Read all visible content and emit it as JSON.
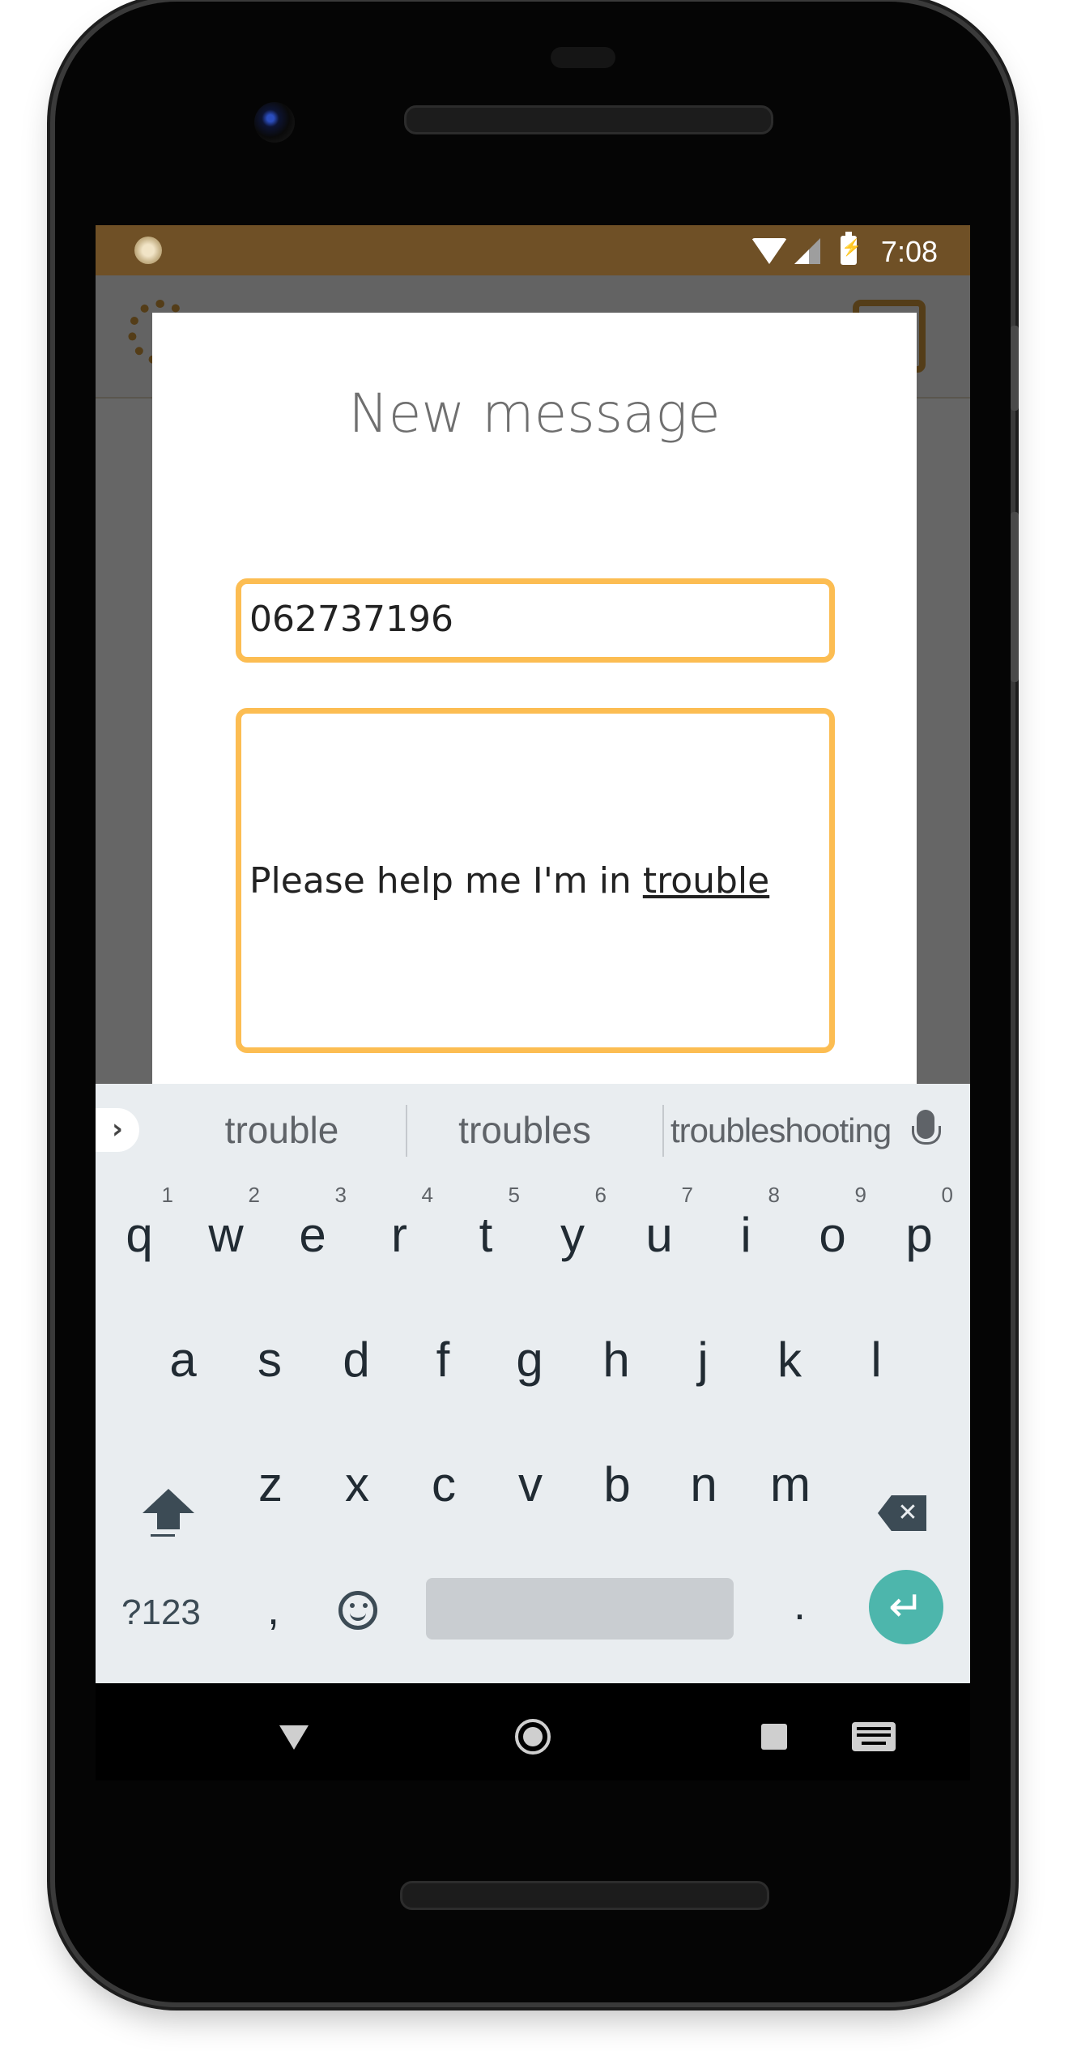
{
  "status_bar": {
    "time": "7:08"
  },
  "dialog": {
    "title": "New message",
    "phone_number": "062737196",
    "message_prefix": "Please help me I'm in ",
    "message_current_word": "trouble"
  },
  "keyboard": {
    "suggestions": [
      "trouble",
      "troubles",
      "troubleshooting"
    ],
    "row1": [
      {
        "letter": "q",
        "num": "1"
      },
      {
        "letter": "w",
        "num": "2"
      },
      {
        "letter": "e",
        "num": "3"
      },
      {
        "letter": "r",
        "num": "4"
      },
      {
        "letter": "t",
        "num": "5"
      },
      {
        "letter": "y",
        "num": "6"
      },
      {
        "letter": "u",
        "num": "7"
      },
      {
        "letter": "i",
        "num": "8"
      },
      {
        "letter": "o",
        "num": "9"
      },
      {
        "letter": "p",
        "num": "0"
      }
    ],
    "row2": [
      "a",
      "s",
      "d",
      "f",
      "g",
      "h",
      "j",
      "k",
      "l"
    ],
    "row3": [
      "z",
      "x",
      "c",
      "v",
      "b",
      "n",
      "m"
    ],
    "symbols_label": "?123",
    "comma": ",",
    "period": ".",
    "enter_glyph": "↵"
  },
  "colors": {
    "status_bar": "#6f5026",
    "field_border": "#fcbd52",
    "enter_key": "#4db6ac",
    "keyboard_bg": "#e9edf0"
  }
}
